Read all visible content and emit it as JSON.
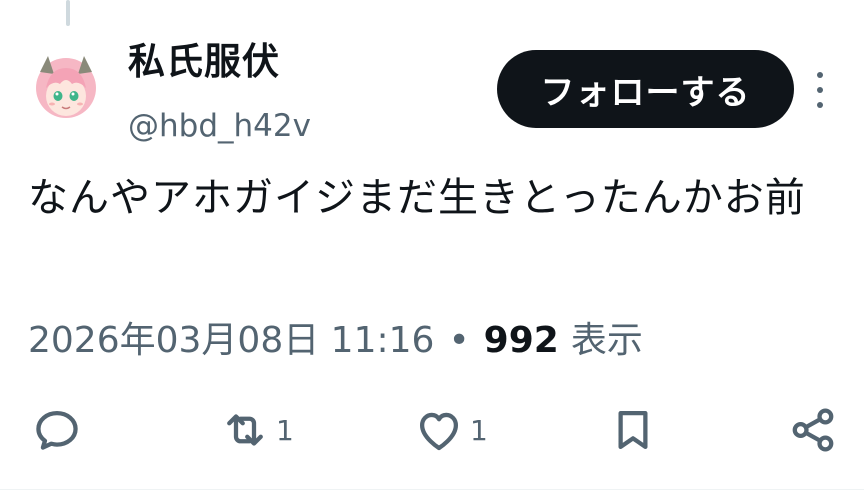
{
  "author": {
    "display_name": "私氏服伏",
    "handle": "@hbd_h42v"
  },
  "follow_label": "フォローする",
  "post": {
    "text": "なんやアホガイジまだ生きとったんかお前"
  },
  "meta": {
    "timestamp": "2026年03月08日 11:16",
    "separator": "•",
    "view_count": "992",
    "view_label": "表示"
  },
  "actions": {
    "reply": {
      "icon": "reply-icon",
      "count": ""
    },
    "repost": {
      "icon": "repost-icon",
      "count": "1"
    },
    "like": {
      "icon": "heart-icon",
      "count": "1"
    },
    "bookmark": {
      "icon": "bookmark-icon",
      "count": ""
    },
    "share": {
      "icon": "share-icon",
      "count": ""
    }
  },
  "colors": {
    "text_primary": "#0f1419",
    "text_secondary": "#536471",
    "follow_bg": "#0f1419",
    "divider": "#eff3f4"
  }
}
